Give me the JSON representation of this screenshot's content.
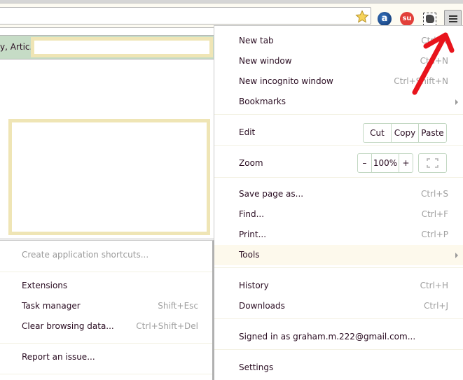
{
  "toolbar": {
    "bookmark_star_icon": "star-icon",
    "extensions": [
      {
        "name": "answers-extension",
        "glyph": "a"
      },
      {
        "name": "stumbleupon-extension",
        "glyph": "su"
      },
      {
        "name": "evernote-extension",
        "glyph": ""
      }
    ],
    "menu_icon": "hamburger-menu-icon"
  },
  "page": {
    "bar_text": "y, Artic.."
  },
  "menu": {
    "items": [
      {
        "label": "New tab",
        "shortcut": "Ctrl+T"
      },
      {
        "label": "New window",
        "shortcut": "Ctrl+N"
      },
      {
        "label": "New incognito window",
        "shortcut": "Ctrl+Shift+N"
      },
      {
        "label": "Bookmarks",
        "shortcut": ""
      },
      {
        "label": "Edit",
        "shortcut": ""
      },
      {
        "label": "Zoom",
        "shortcut": ""
      },
      {
        "label": "Save page as...",
        "shortcut": "Ctrl+S"
      },
      {
        "label": "Find...",
        "shortcut": "Ctrl+F"
      },
      {
        "label": "Print...",
        "shortcut": "Ctrl+P"
      },
      {
        "label": "Tools",
        "shortcut": ""
      },
      {
        "label": "History",
        "shortcut": "Ctrl+H"
      },
      {
        "label": "Downloads",
        "shortcut": "Ctrl+J"
      },
      {
        "label": "Signed in as graham.m.222@gmail.com...",
        "shortcut": ""
      },
      {
        "label": "Settings",
        "shortcut": ""
      }
    ],
    "edit_buttons": {
      "cut": "Cut",
      "copy": "Copy",
      "paste": "Paste"
    },
    "zoom_controls": {
      "minus": "–",
      "level": "100%",
      "plus": "+"
    }
  },
  "tools_submenu": {
    "items": [
      {
        "label": "Create application shortcuts...",
        "shortcut": "",
        "disabled": true
      },
      {
        "label": "Extensions",
        "shortcut": ""
      },
      {
        "label": "Task manager",
        "shortcut": "Shift+Esc"
      },
      {
        "label": "Clear browsing data...",
        "shortcut": "Ctrl+Shift+Del"
      },
      {
        "label": "Report an issue...",
        "shortcut": ""
      }
    ]
  },
  "colors": {
    "menu_highlight": "#fdf9ec",
    "annotation_arrow": "#e8141c",
    "page_accent": "#efe5b5",
    "page_bar": "#c6dcc6"
  }
}
